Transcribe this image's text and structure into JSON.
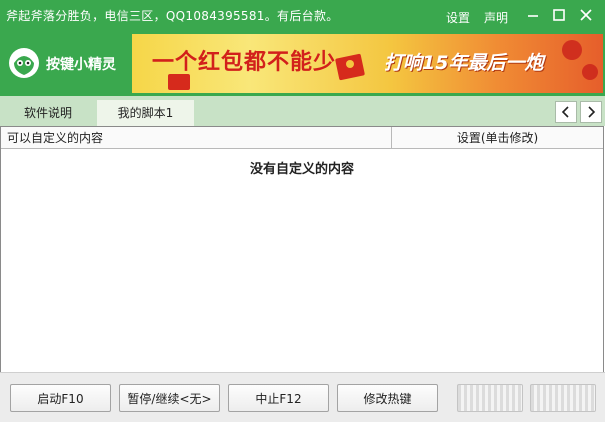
{
  "window": {
    "title": "斧起斧落分胜负，电信三区，QQ1084395581。有后台款。",
    "settings_label": "设置",
    "statement_label": "声明"
  },
  "brand": {
    "logo_text": "按键小精灵",
    "colors": {
      "titlebar": "#3aa84e",
      "tabbar": "#c8e2c6",
      "ad_red": "#d2201b"
    }
  },
  "ad": {
    "main_text": "一个红包都不能少",
    "right_text": "打响15年最后一炮"
  },
  "tabs": [
    {
      "label": "软件说明",
      "active": false
    },
    {
      "label": "我的脚本1",
      "active": true
    }
  ],
  "table": {
    "col_left": "可以自定义的内容",
    "col_right": "设置(单击修改)",
    "empty_message": "没有自定义的内容"
  },
  "buttons": {
    "start": "启动F10",
    "pause": "暂停/继续<无>",
    "stop": "中止F12",
    "hotkey": "修改热键"
  },
  "icons": [
    "minimize-icon",
    "maximize-icon",
    "close-icon",
    "chevron-left-icon",
    "chevron-right-icon",
    "mascot-icon"
  ]
}
